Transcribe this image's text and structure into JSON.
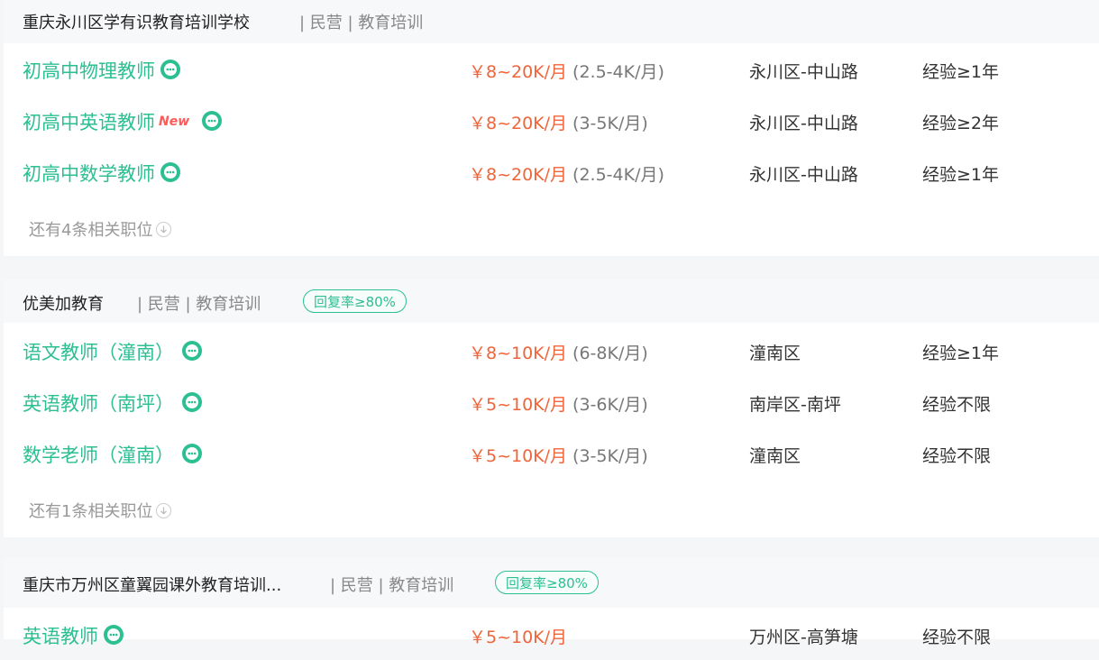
{
  "accent_color": "#2bbf91",
  "salary_color": "#f0643a",
  "companies": [
    {
      "name": "重庆永川区学有识教育培训学校",
      "tags": "| 民营 | 教育培训",
      "badge": "",
      "jobs": [
        {
          "title": "初高中物理教师",
          "new": "",
          "salary": "￥8~20K/月",
          "salary_sub": "(2.5-4K/月)",
          "location": "永川区-中山路",
          "experience": "经验≥1年",
          "icon": "chat-bubble-icon"
        },
        {
          "title": "初高中英语教师",
          "new": "New",
          "salary": "￥8~20K/月",
          "salary_sub": "(3-5K/月)",
          "location": "永川区-中山路",
          "experience": "经验≥2年",
          "icon": "chat-bubble-icon"
        },
        {
          "title": "初高中数学教师",
          "new": "",
          "salary": "￥8~20K/月",
          "salary_sub": "(2.5-4K/月)",
          "location": "永川区-中山路",
          "experience": "经验≥1年",
          "icon": "chat-bubble-icon"
        }
      ],
      "more": "还有4条相关职位"
    },
    {
      "name": "优美加教育",
      "tags": "| 民营 | 教育培训",
      "badge": "回复率≥80%",
      "jobs": [
        {
          "title": "语文教师（潼南）",
          "new": "",
          "salary": "￥8~10K/月",
          "salary_sub": "(6-8K/月)",
          "location": "潼南区",
          "experience": "经验≥1年",
          "icon": "chat-bubble-icon"
        },
        {
          "title": "英语教师（南坪）",
          "new": "",
          "salary": "￥5~10K/月",
          "salary_sub": "(3-6K/月)",
          "location": "南岸区-南坪",
          "experience": "经验不限",
          "icon": "chat-bubble-icon"
        },
        {
          "title": "数学老师（潼南）",
          "new": "",
          "salary": "￥5~10K/月",
          "salary_sub": "(3-5K/月)",
          "location": "潼南区",
          "experience": "经验不限",
          "icon": "chat-bubble-icon"
        }
      ],
      "more": "还有1条相关职位"
    },
    {
      "name": "重庆市万州区童翼园课外教育培训...",
      "tags": "| 民营 | 教育培训",
      "badge": "回复率≥80%",
      "jobs": [
        {
          "title": "英语教师",
          "new": "",
          "salary": "￥5~10K/月",
          "salary_sub": "",
          "location": "万州区-高笋塘",
          "experience": "经验不限",
          "icon": "chat-bubble-icon"
        }
      ],
      "more": ""
    }
  ]
}
